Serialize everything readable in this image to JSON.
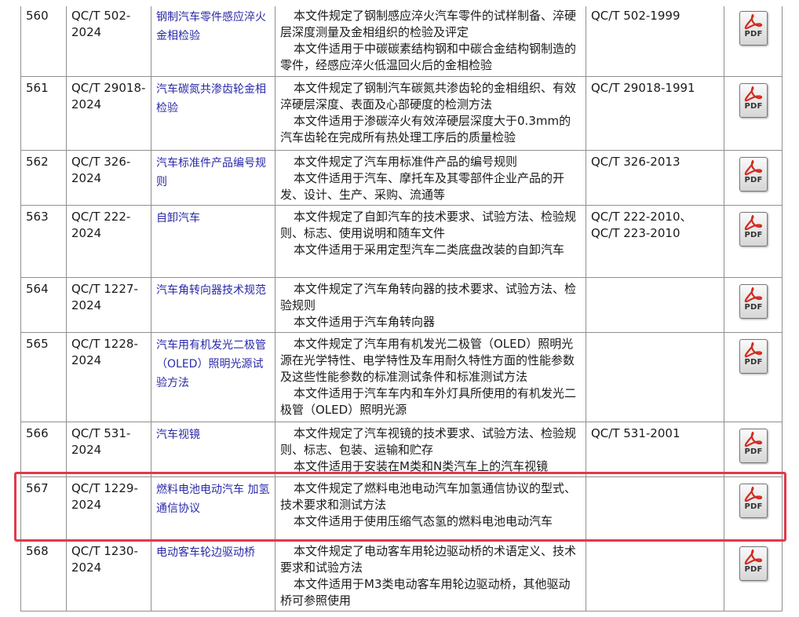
{
  "rows": [
    {
      "num": "560",
      "code": "QC/T 502-2024",
      "title": "钢制汽车零件感应淬火金相检验",
      "desc": [
        "本文件规定了钢制感应淬火汽车零件的试样制备、淬硬层深度测量及金相组织的检验及评定",
        "本文件适用于中碳碳素结构钢和中碳合金结构钢制造的零件，经感应淬火低温回火后的金相检验"
      ],
      "replaces": "QC/T 502-1999",
      "pdf_label": "PDF"
    },
    {
      "num": "561",
      "code": "QC/T 29018-2024",
      "title": "汽车碳氮共渗齿轮金相检验",
      "desc": [
        "本文件规定了钢制汽车碳氮共渗齿轮的金相组织、有效淬硬层深度、表面及心部硬度的检测方法",
        "本文件适用于渗碳淬火有效淬硬层深度大于0.3mm的汽车齿轮在完成所有热处理工序后的质量检验"
      ],
      "replaces": "QC/T 29018-1991",
      "pdf_label": "PDF"
    },
    {
      "num": "562",
      "code": "QC/T 326-2024",
      "title": "汽车标准件产品编号规则",
      "desc": [
        "本文件规定了汽车用标准件产品的编号规则",
        "本文件适用于汽车、摩托车及其零部件企业产品的开发、设计、生产、采购、流通等"
      ],
      "replaces": "QC/T 326-2013",
      "pdf_label": "PDF"
    },
    {
      "num": "563",
      "code": "QC/T 222-2024",
      "title": "自卸汽车",
      "desc": [
        "本文件规定了自卸汽车的技术要求、试验方法、检验规则、标志、使用说明和随车文件",
        "本文件适用于采用定型汽车二类底盘改装的自卸汽车"
      ],
      "replaces": "QC/T 222-2010、QC/T 223-2010",
      "pdf_label": "PDF"
    },
    {
      "num": "564",
      "code": "QC/T 1227-2024",
      "title": "汽车角转向器技术规范",
      "desc": [
        "本文件规定了汽车角转向器的技术要求、试验方法、检验规则",
        "本文件适用于汽车角转向器"
      ],
      "replaces": "",
      "pdf_label": "PDF"
    },
    {
      "num": "565",
      "code": "QC/T 1228-2024",
      "title": "汽车用有机发光二极管（OLED）照明光源试验方法",
      "desc": [
        "本文件规定了汽车用有机发光二极管（OLED）照明光源在光学特性、电学特性及车用耐久特性方面的性能参数及这些性能参数的标准测试条件和标准测试方法",
        "本文件适用于汽车车内和车外灯具所使用的有机发光二极管（OLED）照明光源"
      ],
      "replaces": "",
      "pdf_label": "PDF"
    },
    {
      "num": "566",
      "code": "QC/T 531-2024",
      "title": "汽车视镜",
      "desc": [
        "本文件规定了汽车视镜的技术要求、试验方法、检验规则、标志、包装、运输和贮存",
        "本文件适用于安装在M类和N类汽车上的汽车视镜"
      ],
      "replaces": "QC/T 531-2001",
      "pdf_label": "PDF"
    },
    {
      "num": "567",
      "code": "QC/T 1229-2024",
      "title": "燃料电池电动汽车 加氢通信协议",
      "desc": [
        "本文件规定了燃料电池电动汽车加氢通信协议的型式、技术要求和测试方法",
        "本文件适用于使用压缩气态氢的燃料电池电动汽车"
      ],
      "replaces": "",
      "pdf_label": "PDF"
    },
    {
      "num": "568",
      "code": "QC/T 1230-2024",
      "title": "电动客车轮边驱动桥",
      "desc": [
        "本文件规定了电动客车用轮边驱动桥的术语定义、技术要求和试验方法",
        "本文件适用于M3类电动客车用轮边驱动桥，其他驱动桥可参照使用"
      ],
      "replaces": "",
      "pdf_label": "PDF"
    }
  ],
  "colors": {
    "link": "#2a2aa8",
    "border": "#8f8f8f",
    "highlight": "#e03a4c",
    "pdf_red": "#d22b1f"
  },
  "icons": {
    "pdf": "pdf-icon"
  }
}
